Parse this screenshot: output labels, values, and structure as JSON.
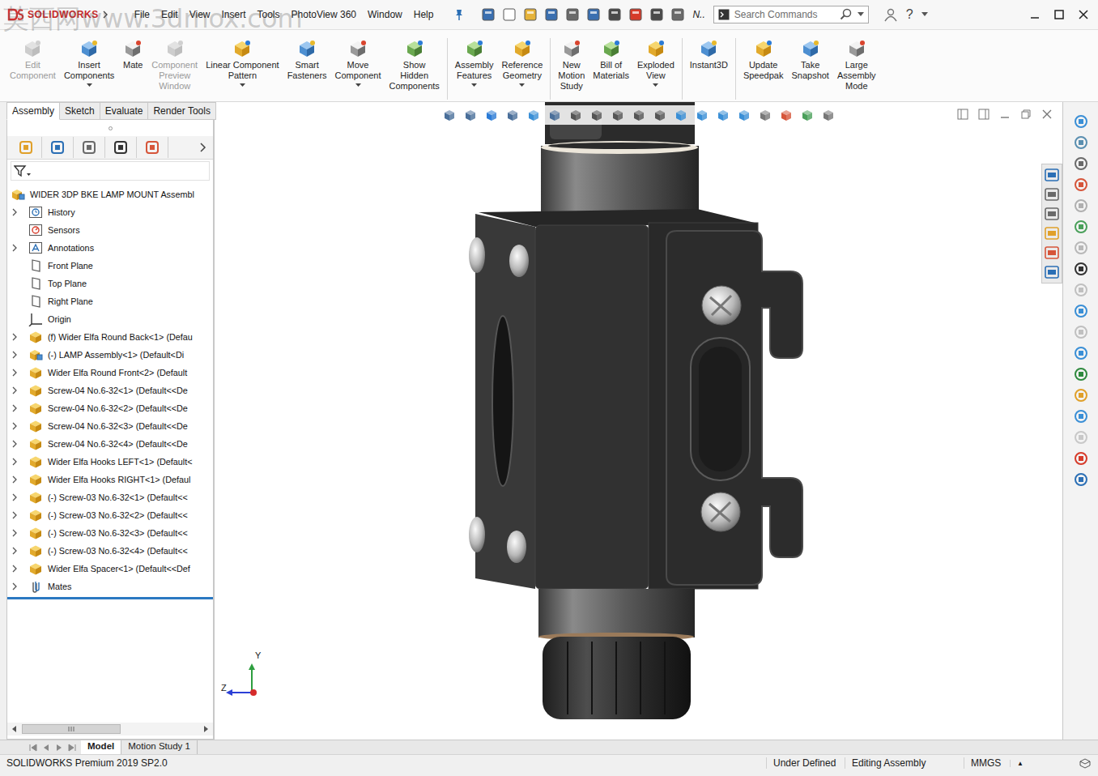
{
  "window": {
    "logo": "SOLIDWORKS",
    "watermark": "莫西网www.3dmox.com"
  },
  "menu": [
    "File",
    "Edit",
    "View",
    "Insert",
    "Tools",
    "PhotoView 360",
    "Window",
    "Help"
  ],
  "quick_access": {
    "overflow_label": "N.."
  },
  "search": {
    "placeholder": "Search Commands"
  },
  "help": {
    "label": "?"
  },
  "ribbon_groups": [
    [
      {
        "lines": [
          "Edit",
          "Component"
        ],
        "disabled": true,
        "dropdown": false
      },
      {
        "lines": [
          "Insert",
          "Components"
        ],
        "disabled": false,
        "dropdown": true
      },
      {
        "lines": [
          "Mate"
        ],
        "disabled": false,
        "dropdown": false
      },
      {
        "lines": [
          "Component",
          "Preview",
          "Window"
        ],
        "disabled": true,
        "dropdown": false
      },
      {
        "lines": [
          "Linear Component",
          "Pattern"
        ],
        "disabled": false,
        "dropdown": true
      },
      {
        "lines": [
          "Smart",
          "Fasteners"
        ],
        "disabled": false,
        "dropdown": false
      },
      {
        "lines": [
          "Move",
          "Component"
        ],
        "disabled": false,
        "dropdown": true
      },
      {
        "lines": [
          "Show",
          "Hidden",
          "Components"
        ],
        "disabled": false,
        "dropdown": false
      }
    ],
    [
      {
        "lines": [
          "Assembly",
          "Features"
        ],
        "disabled": false,
        "dropdown": true
      },
      {
        "lines": [
          "Reference",
          "Geometry"
        ],
        "disabled": false,
        "dropdown": true
      }
    ],
    [
      {
        "lines": [
          "New",
          "Motion",
          "Study"
        ],
        "disabled": false,
        "dropdown": false
      },
      {
        "lines": [
          "Bill of",
          "Materials"
        ],
        "disabled": false,
        "dropdown": false
      },
      {
        "lines": [
          "Exploded",
          "View"
        ],
        "disabled": false,
        "dropdown": true
      }
    ],
    [
      {
        "lines": [
          "Instant3D"
        ],
        "disabled": false,
        "dropdown": false
      }
    ],
    [
      {
        "lines": [
          "Update",
          "Speedpak"
        ],
        "disabled": false,
        "dropdown": false
      },
      {
        "lines": [
          "Take",
          "Snapshot"
        ],
        "disabled": false,
        "dropdown": false
      },
      {
        "lines": [
          "Large",
          "Assembly",
          "Mode"
        ],
        "disabled": false,
        "dropdown": false
      }
    ]
  ],
  "command_tabs": [
    {
      "label": "Assembly",
      "selected": true
    },
    {
      "label": "Sketch",
      "selected": false
    },
    {
      "label": "Evaluate",
      "selected": false
    },
    {
      "label": "Render Tools",
      "selected": false
    }
  ],
  "feature_tree": {
    "root": {
      "label": "WIDER 3DP BKE LAMP MOUNT Assembl"
    },
    "items": [
      {
        "label": "History",
        "kind": "history",
        "expandable": true
      },
      {
        "label": "Sensors",
        "kind": "sensors",
        "expandable": false
      },
      {
        "label": "Annotations",
        "kind": "annotations",
        "expandable": true
      },
      {
        "label": "Front Plane",
        "kind": "plane",
        "expandable": false
      },
      {
        "label": "Top Plane",
        "kind": "plane",
        "expandable": false
      },
      {
        "label": "Right Plane",
        "kind": "plane",
        "expandable": false
      },
      {
        "label": "Origin",
        "kind": "origin",
        "expandable": false
      },
      {
        "label": "(f) Wider Elfa Round Back<1> (Defau",
        "kind": "part",
        "expandable": true
      },
      {
        "label": "(-) LAMP Assembly<1> (Default<Di",
        "kind": "assembly",
        "expandable": true
      },
      {
        "label": "Wider Elfa Round Front<2> (Default",
        "kind": "part",
        "expandable": true
      },
      {
        "label": "Screw-04 No.6-32<1> (Default<<De",
        "kind": "part",
        "expandable": true
      },
      {
        "label": "Screw-04 No.6-32<2> (Default<<De",
        "kind": "part",
        "expandable": true
      },
      {
        "label": "Screw-04 No.6-32<3> (Default<<De",
        "kind": "part",
        "expandable": true
      },
      {
        "label": "Screw-04 No.6-32<4> (Default<<De",
        "kind": "part",
        "expandable": true
      },
      {
        "label": "Wider Elfa Hooks LEFT<1> (Default<",
        "kind": "part",
        "expandable": true
      },
      {
        "label": "Wider Elfa Hooks RIGHT<1> (Defaul",
        "kind": "part",
        "expandable": true
      },
      {
        "label": "(-) Screw-03 No.6-32<1> (Default<<",
        "kind": "part",
        "expandable": true
      },
      {
        "label": "(-) Screw-03 No.6-32<2> (Default<<",
        "kind": "part",
        "expandable": true
      },
      {
        "label": "(-) Screw-03 No.6-32<3> (Default<<",
        "kind": "part",
        "expandable": true
      },
      {
        "label": "(-) Screw-03 No.6-32<4> (Default<<",
        "kind": "part",
        "expandable": true
      },
      {
        "label": "Wider Elfa Spacer<1> (Default<<Def",
        "kind": "part",
        "expandable": true
      },
      {
        "label": "Mates",
        "kind": "mates",
        "expandable": true
      }
    ]
  },
  "triad": {
    "y_label": "Y",
    "z_label": "Z"
  },
  "bottom_tabs": [
    {
      "label": "Model",
      "selected": true
    },
    {
      "label": "Motion Study 1",
      "selected": false
    }
  ],
  "status_bar": {
    "product": "SOLIDWORKS Premium 2019 SP2.0",
    "state": "Under Defined",
    "mode": "Editing Assembly",
    "units": "MMGS",
    "units_menu": "▲"
  }
}
